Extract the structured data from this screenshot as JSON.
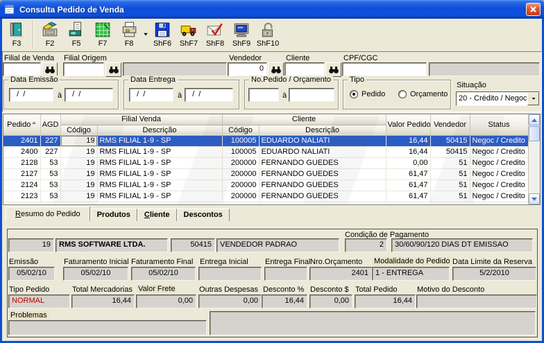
{
  "window": {
    "title": "Consulta Pedido de Venda"
  },
  "colors": {
    "titlebar_gradient_top": "#2B6BE8",
    "titlebar_gradient_bottom": "#0839A8",
    "selection_bg": "#2A5CC6",
    "alert_text": "#C00000",
    "label_highlight_bg": "#E9E4C9",
    "close_button_bg": "#D8512F",
    "panel_bg": "#ECE9D8",
    "readonly_field_bg": "#D6D3CE"
  },
  "toolbar": {
    "buttons": [
      {
        "key": "F3",
        "icon": "exit-door-icon"
      },
      {
        "key": "F2",
        "icon": "open-folder-icon"
      },
      {
        "key": "F5",
        "icon": "print-preview-icon"
      },
      {
        "key": "F7",
        "icon": "spreadsheet-icon"
      },
      {
        "key": "F8",
        "icon": "printer-icon"
      },
      {
        "key": "ShF6",
        "icon": "save-floppy-icon"
      },
      {
        "key": "ShF7",
        "icon": "delivery-truck-icon"
      },
      {
        "key": "ShF8",
        "icon": "mail-check-icon"
      },
      {
        "key": "ShF9",
        "icon": "monitor-icon"
      },
      {
        "key": "ShF10",
        "icon": "padlock-icon"
      }
    ]
  },
  "filters": {
    "filial_de_venda": {
      "label": "Filial de Venda",
      "value": ""
    },
    "filial_origem": {
      "label": "Filial Origem",
      "value": "",
      "descricao": ""
    },
    "vendedor": {
      "label": "Vendedor",
      "value": "0"
    },
    "cliente": {
      "label": "Cliente",
      "value": ""
    },
    "cpf_cgc": {
      "label": "CPF/CGC",
      "value": "",
      "razao": ""
    },
    "data_emissao": {
      "legend": "Data Emissão",
      "from": "  /  /",
      "to_sep": "à",
      "to": "  /  /"
    },
    "data_entrega": {
      "legend": "Data Entrega",
      "from": "  /  /",
      "to_sep": "à",
      "to": "  /  /"
    },
    "pedido_orcamento": {
      "legend": "No.Pedido / Orçamento",
      "from": "",
      "to_sep": "à",
      "to": ""
    },
    "tipo": {
      "legend": "Tipo",
      "options": [
        {
          "label": "Pedido",
          "selected": true
        },
        {
          "label": "Orçamento",
          "selected": false
        }
      ]
    },
    "situacao": {
      "label": "Situação",
      "value": "20 - Crédito / Negoc"
    }
  },
  "grid": {
    "header": {
      "pedido": "Pedido",
      "agd": "AGD",
      "filial_venda": "Filial Venda",
      "cliente": "Cliente",
      "codigo": "Código",
      "descricao": "Descrição",
      "valor_pedido": "Valor Pedido",
      "vendedor": "Vendedor",
      "status": "Status"
    },
    "rows": [
      {
        "pedido": "2401",
        "agd": "227",
        "filial_cod": "19",
        "filial_desc": "RMS FILIAL 1-9 - SP",
        "cliente_cod": "100005",
        "cliente_desc": "EDUARDO NALIATI",
        "valor": "16,44",
        "vendedor": "50415",
        "status": "Negoc / Credito",
        "selected": true
      },
      {
        "pedido": "2400",
        "agd": "227",
        "filial_cod": "19",
        "filial_desc": "RMS FILIAL 1-9 - SP",
        "cliente_cod": "100005",
        "cliente_desc": "EDUARDO NALIATI",
        "valor": "16,44",
        "vendedor": "50415",
        "status": "Negoc / Credito",
        "selected": false
      },
      {
        "pedido": "2128",
        "agd": "53",
        "filial_cod": "19",
        "filial_desc": "RMS FILIAL 1-9 - SP",
        "cliente_cod": "200000",
        "cliente_desc": "FERNANDO GUEDES",
        "valor": "0,00",
        "vendedor": "51",
        "status": "Negoc / Credito",
        "selected": false
      },
      {
        "pedido": "2127",
        "agd": "53",
        "filial_cod": "19",
        "filial_desc": "RMS FILIAL 1-9 - SP",
        "cliente_cod": "200000",
        "cliente_desc": "FERNANDO GUEDES",
        "valor": "61,47",
        "vendedor": "51",
        "status": "Negoc / Credito",
        "selected": false
      },
      {
        "pedido": "2124",
        "agd": "53",
        "filial_cod": "19",
        "filial_desc": "RMS FILIAL 1-9 - SP",
        "cliente_cod": "200000",
        "cliente_desc": "FERNANDO GUEDES",
        "valor": "61,47",
        "vendedor": "51",
        "status": "Negoc / Credito",
        "selected": false
      },
      {
        "pedido": "2123",
        "agd": "53",
        "filial_cod": "19",
        "filial_desc": "RMS FILIAL 1-9 - SP",
        "cliente_cod": "200000",
        "cliente_desc": "FERNANDO GUEDES",
        "valor": "61,47",
        "vendedor": "51",
        "status": "Negoc / Credito",
        "selected": false
      }
    ]
  },
  "tabs": [
    {
      "hot": "R",
      "rest": "esumo do Pedido",
      "active": true
    },
    {
      "hot": "",
      "rest": "Produtos",
      "active": false
    },
    {
      "hot": "C",
      "rest": "liente",
      "active": false
    },
    {
      "hot": "",
      "rest": "Descontos",
      "active": false
    }
  ],
  "resumo": {
    "filial_codigo": "19",
    "filial_nome": "RMS SOFTWARE LTDA.",
    "vendedor_codigo": "50415",
    "vendedor_nome": "VENDEDOR PADRAO",
    "condicao_pagamento": {
      "label": "Condição de Pagamento",
      "codigo": "2",
      "descricao": "30/60/90/120 DIAS DT EMISSAO"
    },
    "emissao": {
      "label": "Emissão",
      "value": "05/02/10"
    },
    "faturamento_inicial": {
      "label": "Faturamento Inicial",
      "value": "05/02/10"
    },
    "faturamento_final": {
      "label": "Faturamento Final",
      "value": "05/02/10"
    },
    "entrega_inicial": {
      "label": "Entrega Inicial",
      "value": ""
    },
    "entrega_final": {
      "label": "Entrega Final",
      "value": ""
    },
    "nro_orcamento": {
      "label": "Nro.Orçamento",
      "value": "2401"
    },
    "modalidade": {
      "label": "Modalidade do Pedido",
      "value": "1 - ENTREGA"
    },
    "data_limite": {
      "label": "Data Limite da Reserva",
      "value": "5/2/2010"
    },
    "tipo_pedido": {
      "label": "Tipo Pedido",
      "value": "NORMAL"
    },
    "total_mercadorias": {
      "label": "Total Mercadorias",
      "value": "16,44"
    },
    "valor_frete": {
      "label": "Valor Frete",
      "value": "0,00"
    },
    "outras_despesas": {
      "label": "Outras Despesas",
      "value": "0,00"
    },
    "desconto_pct": {
      "label": "Desconto %",
      "value": "16,44"
    },
    "desconto_valor": {
      "label": "Desconto $",
      "value": "0,00"
    },
    "total_pedido": {
      "label": "Total Pedido",
      "value": "16,44"
    },
    "motivo_desconto": {
      "label": "Motivo do Desconto",
      "value": ""
    },
    "problemas": {
      "label": "Problemas",
      "value": ""
    }
  }
}
